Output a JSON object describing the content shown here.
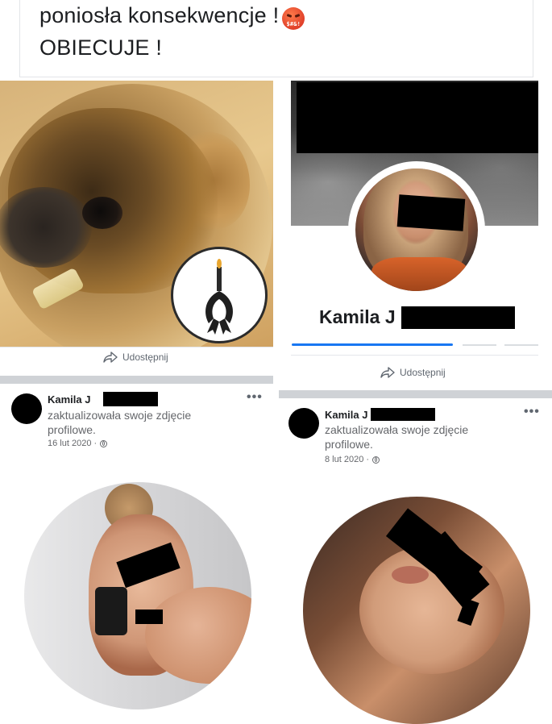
{
  "top_text": {
    "line1": "poniosła konsekwencje  !",
    "line1_emoji": "angry-face-emoji",
    "line2": "OBIECUJE !"
  },
  "left_photo": {
    "description_icon": "mourning-ribbon-candle-icon",
    "share_label": "Udostępnij"
  },
  "right_profile": {
    "name": "Kamila J",
    "share_label": "Udostępnij",
    "active_tab_color": "#1877f2"
  },
  "posts": [
    {
      "author": "Kamila J",
      "action": "zaktualizowała swoje zdjęcie profilowe.",
      "date": "16 lut 2020 ·",
      "more": "•••"
    },
    {
      "author": "Kamila J",
      "action": "zaktualizowała swoje zdjęcie profilowe.",
      "date": "8 lut 2020 ·",
      "more": "•••"
    }
  ],
  "colors": {
    "text": "#1c1e21",
    "secondary_text": "#65676b",
    "divider": "#cfd2d6",
    "redaction": "#000000"
  }
}
